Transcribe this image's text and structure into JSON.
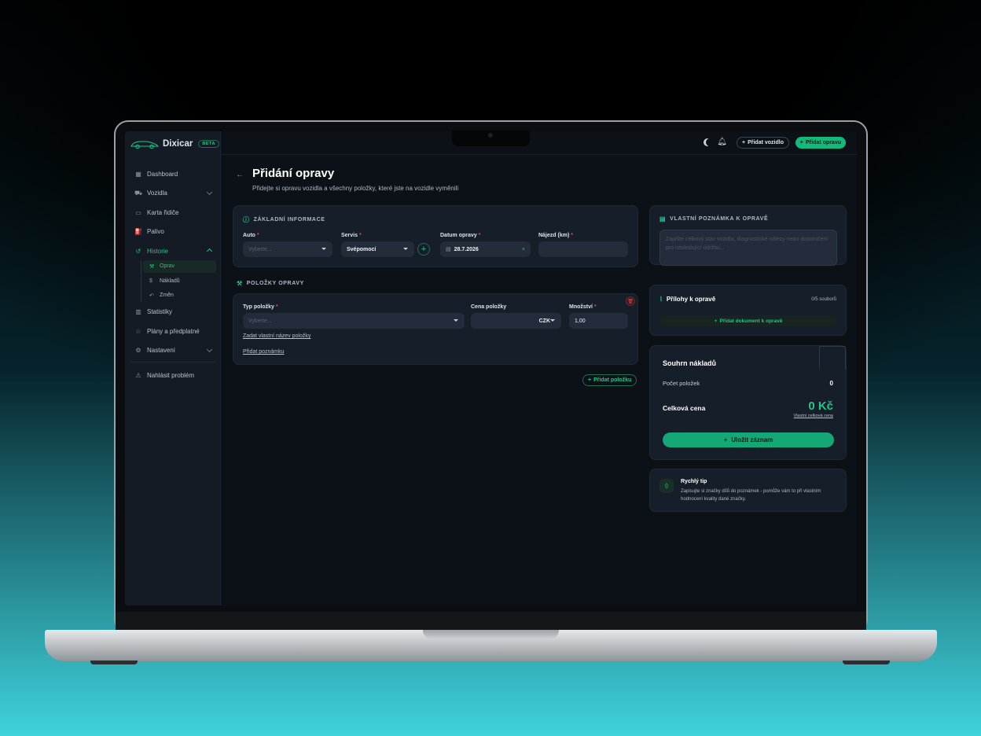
{
  "app": {
    "name": "Dixicar",
    "badge": "BETA"
  },
  "topbar": {
    "moon_icon": "moon-icon",
    "bell_icon": "bell-icon",
    "add_vehicle": "Přidat vozidlo",
    "add_repair": "Přidat opravu"
  },
  "sidebar": {
    "items": [
      {
        "label": "Dashboard",
        "icon": "grid-icon"
      },
      {
        "label": "Vozidla",
        "icon": "car-icon"
      },
      {
        "label": "Karta řidiče",
        "icon": "id-card-icon"
      },
      {
        "label": "Palivo",
        "icon": "fuel-icon"
      },
      {
        "label": "Historie",
        "icon": "history-icon"
      },
      {
        "label": "Statistiky",
        "icon": "chart-icon"
      },
      {
        "label": "Plány a předplatné",
        "icon": "star-icon"
      },
      {
        "label": "Nastavení",
        "icon": "gear-icon"
      },
      {
        "label": "Nahlásit problém",
        "icon": "warning-icon"
      }
    ],
    "history_sub": [
      {
        "label": "Oprav",
        "icon": "wrench-icon"
      },
      {
        "label": "Nákladů",
        "icon": "dollar-icon"
      },
      {
        "label": "Změn",
        "icon": "undo-icon"
      }
    ]
  },
  "page": {
    "title": "Přidání opravy",
    "subtitle": "Přidejte si opravu vozidla a všechny položky, které jste na vozidle vyměnili"
  },
  "basic": {
    "header": "ZÁKLADNÍ INFORMACE",
    "auto_label": "Auto",
    "auto_placeholder": "Vyberte...",
    "servis_label": "Servis",
    "servis_value": "Svépomocí",
    "date_label": "Datum opravy",
    "date_value": "28.7.2026",
    "km_label": "Nájezd (km)",
    "km_value": ""
  },
  "items": {
    "header": "POLOŽKY OPRAVY",
    "type_label": "Typ položky",
    "type_placeholder": "Vyberte...",
    "price_label": "Cena položky",
    "currency": "CZK",
    "qty_label": "Množství",
    "qty_value": "1,00",
    "custom_name_link": "Zadat vlastní název položky",
    "add_note_link": "Přidat poznámku",
    "add_item": "Přidat položku"
  },
  "note": {
    "header": "VLASTNÍ POZNÁMKA K OPRAVĚ",
    "placeholder": "Zapište celkový stav vozidla, diagnostické nálezy nebo doporučení pro následující údržbu..."
  },
  "attachments": {
    "title": "Přílohy k opravě",
    "count": "0/5 souborů",
    "add_doc": "Přidat dokument k opravě"
  },
  "summary": {
    "title": "Souhrn nákladů",
    "count_label": "Počet položek",
    "count_value": "0",
    "total_label": "Celková cena",
    "total_value": "0 Kč",
    "custom_total": "Vlastní celková cena",
    "save": "Uložit záznam"
  },
  "tip": {
    "title": "Rychlý tip",
    "text": "Zapisujte si značky dílů do poznámek - pomůže vám to při vlastním hodnocení kvality dané značky."
  },
  "colors": {
    "accent": "#22c58a",
    "background": "#0c1118",
    "card": "#161e29",
    "danger": "#e5484d"
  }
}
